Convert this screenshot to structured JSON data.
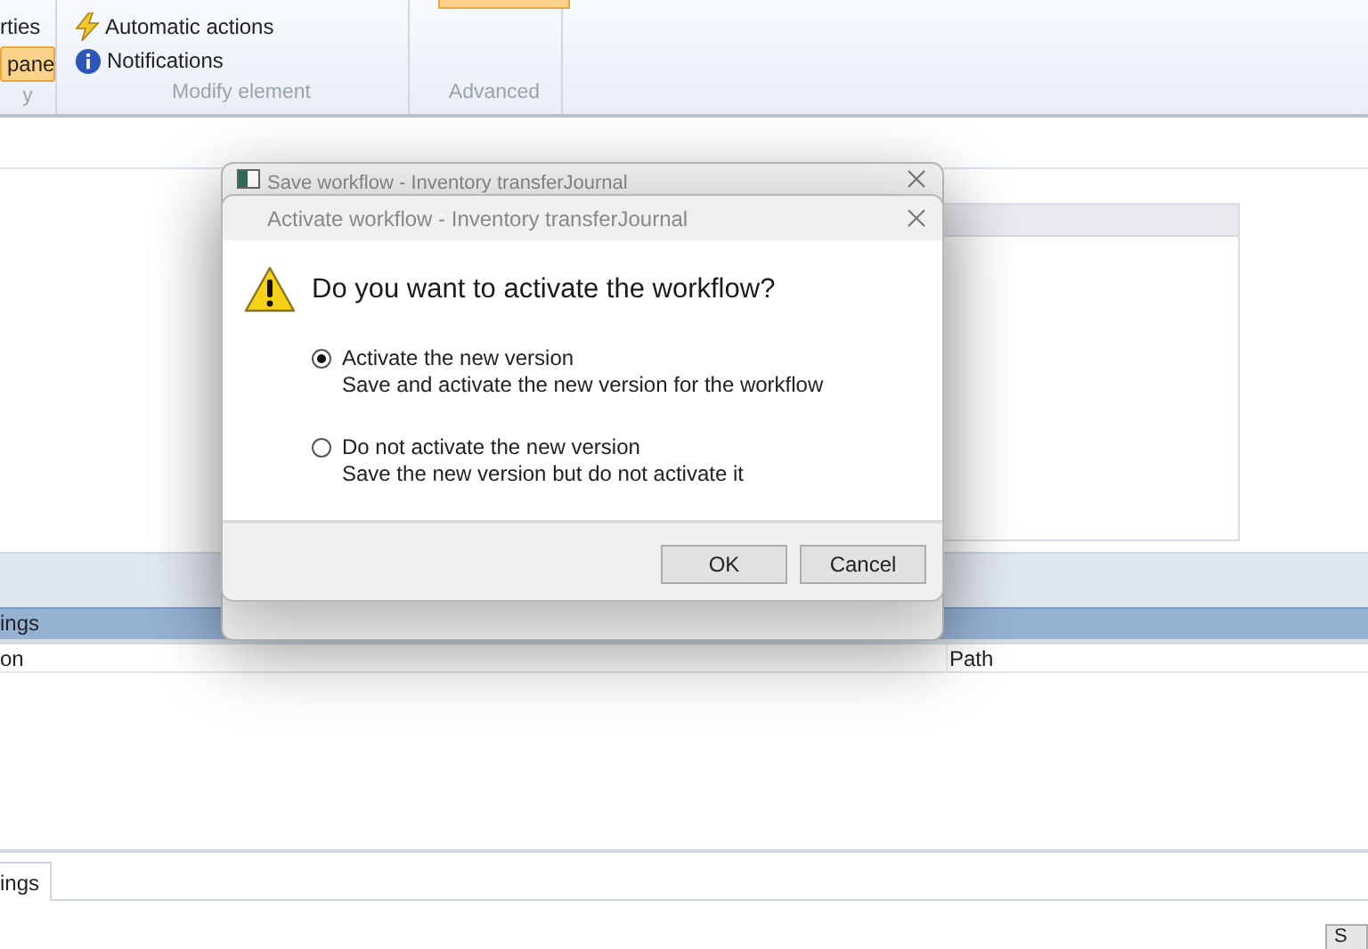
{
  "ribbon": {
    "groups": [
      {
        "items": [
          {
            "label": "rties",
            "kind": "plain"
          },
          {
            "label": "pane",
            "kind": "highlighted"
          }
        ],
        "caption": "y"
      },
      {
        "items": [
          {
            "label": "Automatic actions",
            "kind": "lightning"
          },
          {
            "label": "Notifications",
            "kind": "info"
          }
        ],
        "caption": "Modify element"
      },
      {
        "caption": "Advanced"
      }
    ]
  },
  "grid": {
    "header": "ings",
    "columns": [
      "on",
      "Path"
    ]
  },
  "bottom_tab": "ings",
  "corner_button": "S",
  "back_dialog": {
    "title": "Save workflow - Inventory transferJournal"
  },
  "dialog": {
    "title": "Activate workflow - Inventory transferJournal",
    "question": "Do you want to activate the workflow?",
    "options": [
      {
        "label": "Activate the new version",
        "description": "Save and activate the new version for the workflow",
        "selected": true
      },
      {
        "label": "Do not activate the new version",
        "description": "Save the new version but do not activate it",
        "selected": false
      }
    ],
    "buttons": [
      "OK",
      "Cancel"
    ]
  }
}
